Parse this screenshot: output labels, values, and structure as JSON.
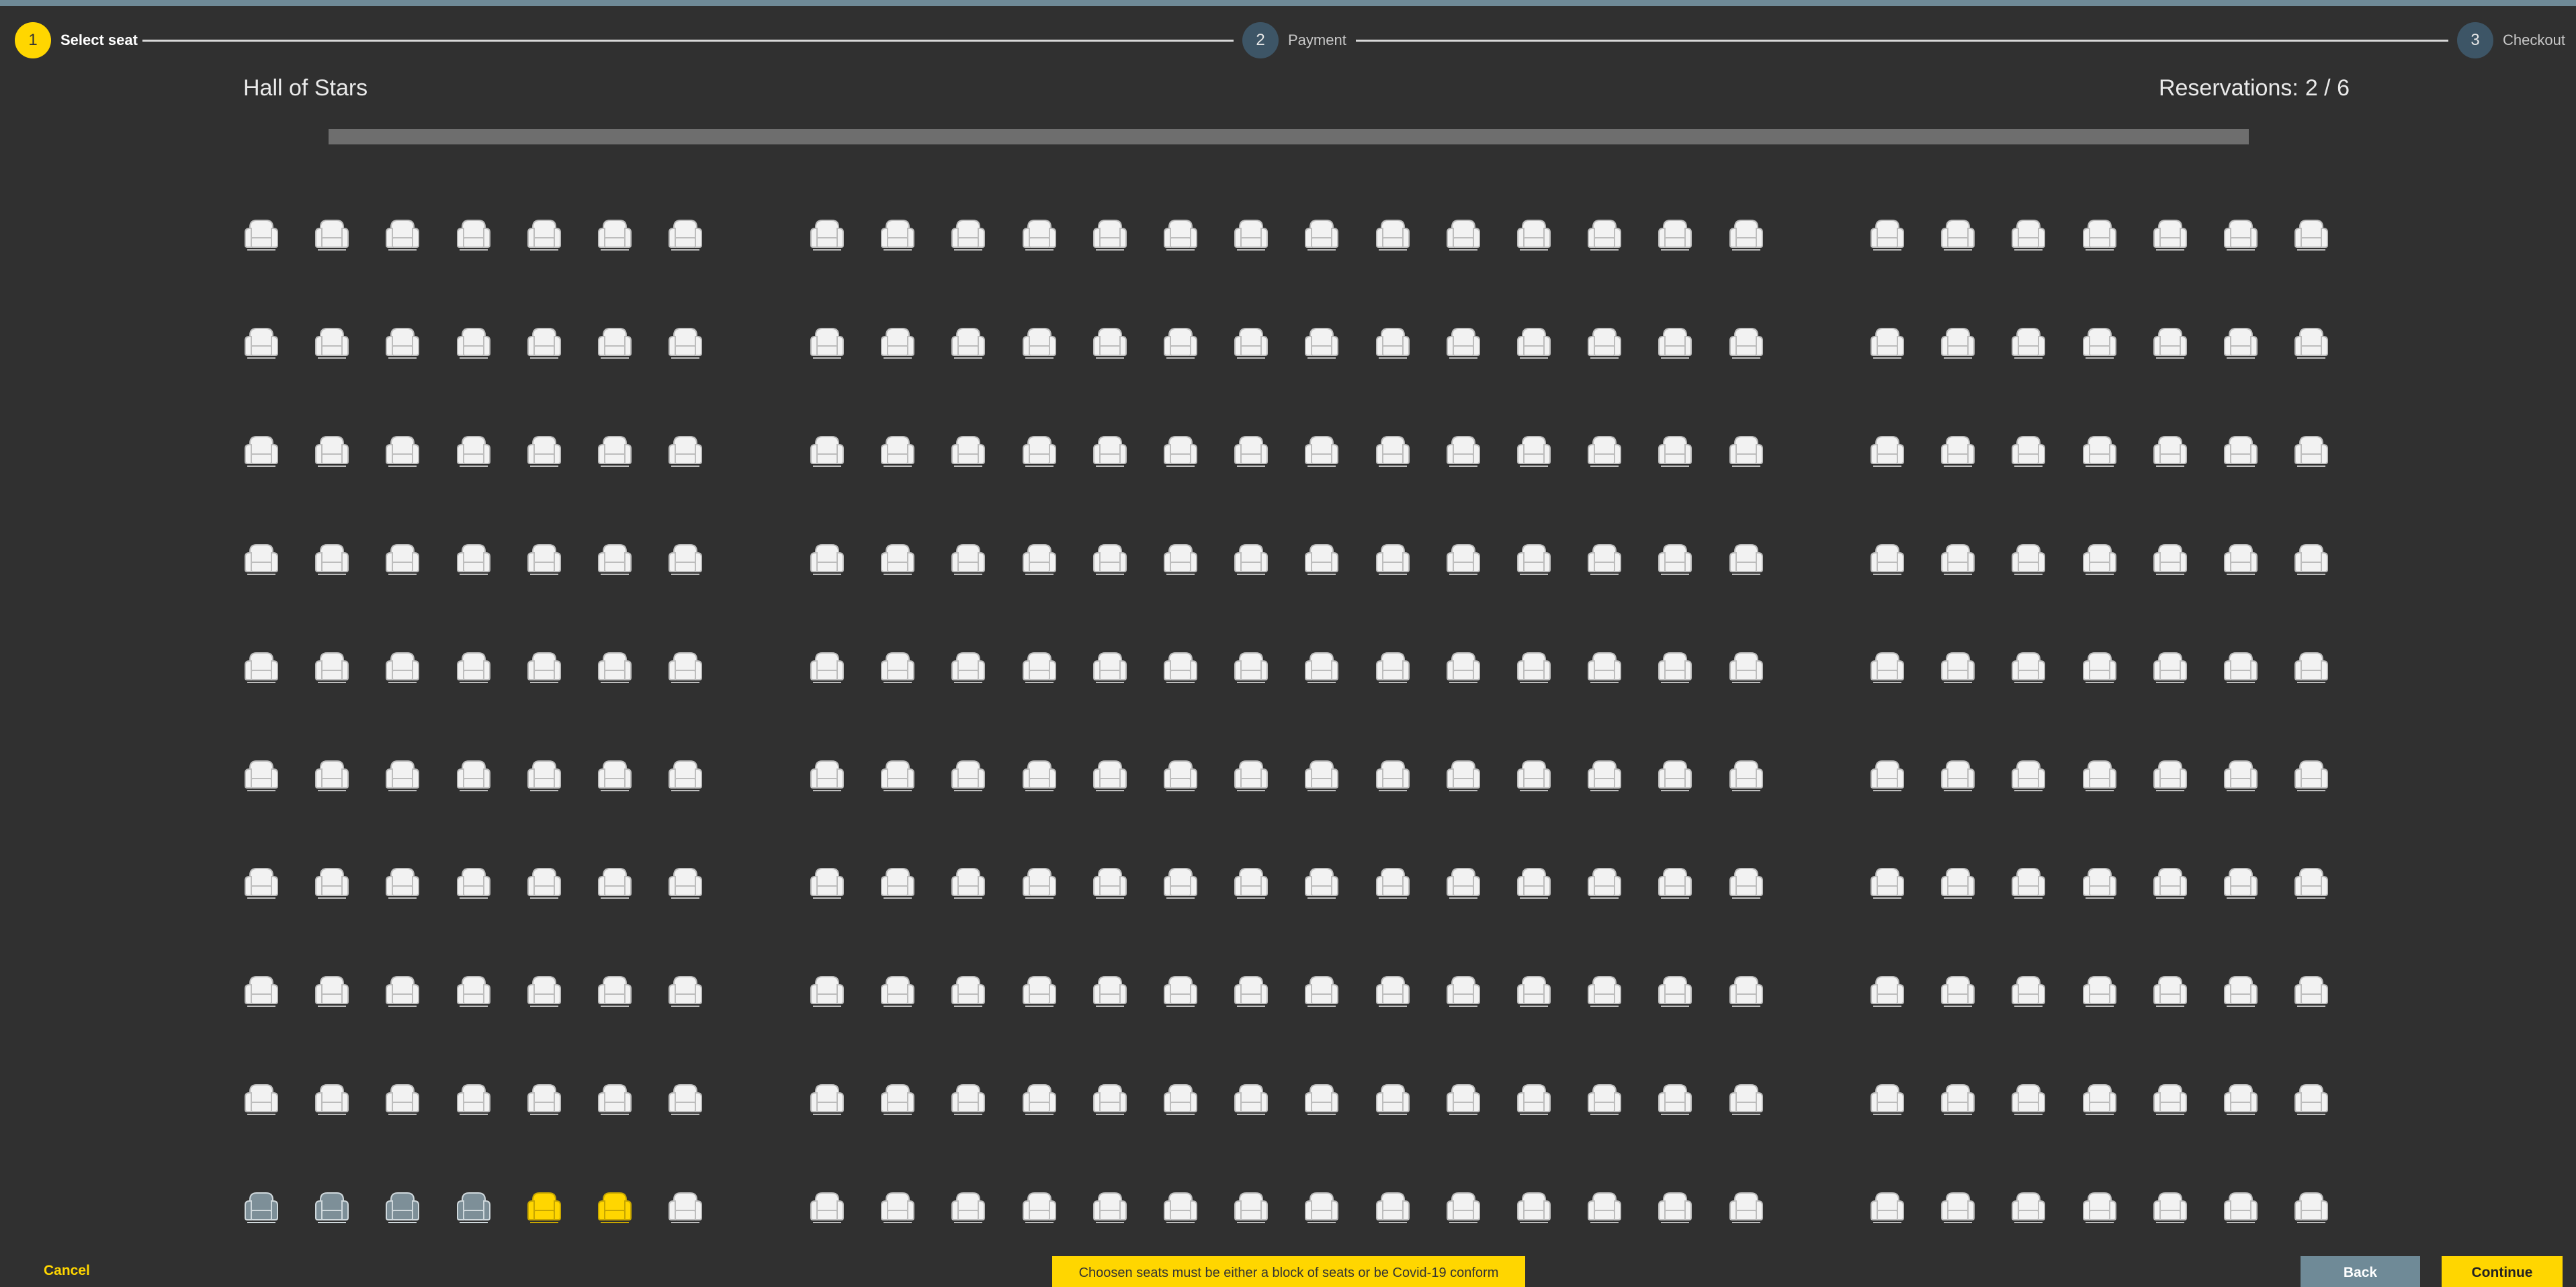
{
  "stepper": {
    "steps": [
      {
        "number": "1",
        "label": "Select seat",
        "state": "active"
      },
      {
        "number": "2",
        "label": "Payment",
        "state": "inactive"
      },
      {
        "number": "3",
        "label": "Checkout",
        "state": "inactive"
      }
    ]
  },
  "header": {
    "hall_name": "Hall of Stars",
    "reservations_label": "Reservations:",
    "reservations_value": "2 / 6"
  },
  "seating": {
    "rows": 10,
    "blocks": [
      {
        "name": "left",
        "seats_per_row": 7
      },
      {
        "name": "center",
        "seats_per_row": 14
      },
      {
        "name": "right",
        "seats_per_row": 7
      }
    ],
    "seat_states": {
      "available_color": "#f2f2f2",
      "taken_color": "#7d8f98",
      "selected_color": "#ffd600"
    },
    "taken_seats": [
      {
        "row": 10,
        "block": "left",
        "seat": 1
      },
      {
        "row": 10,
        "block": "left",
        "seat": 2
      },
      {
        "row": 10,
        "block": "left",
        "seat": 3
      },
      {
        "row": 10,
        "block": "left",
        "seat": 4
      }
    ],
    "selected_seats": [
      {
        "row": 10,
        "block": "left",
        "seat": 5
      },
      {
        "row": 10,
        "block": "left",
        "seat": 6
      }
    ]
  },
  "footer": {
    "cancel_label": "Cancel",
    "notice_text": "Choosen seats must be either a block of seats or be Covid-19 conform",
    "back_label": "Back",
    "continue_label": "Continue"
  },
  "colors": {
    "background": "#303030",
    "accent": "#ffd600",
    "secondary": "#6f8a97"
  }
}
